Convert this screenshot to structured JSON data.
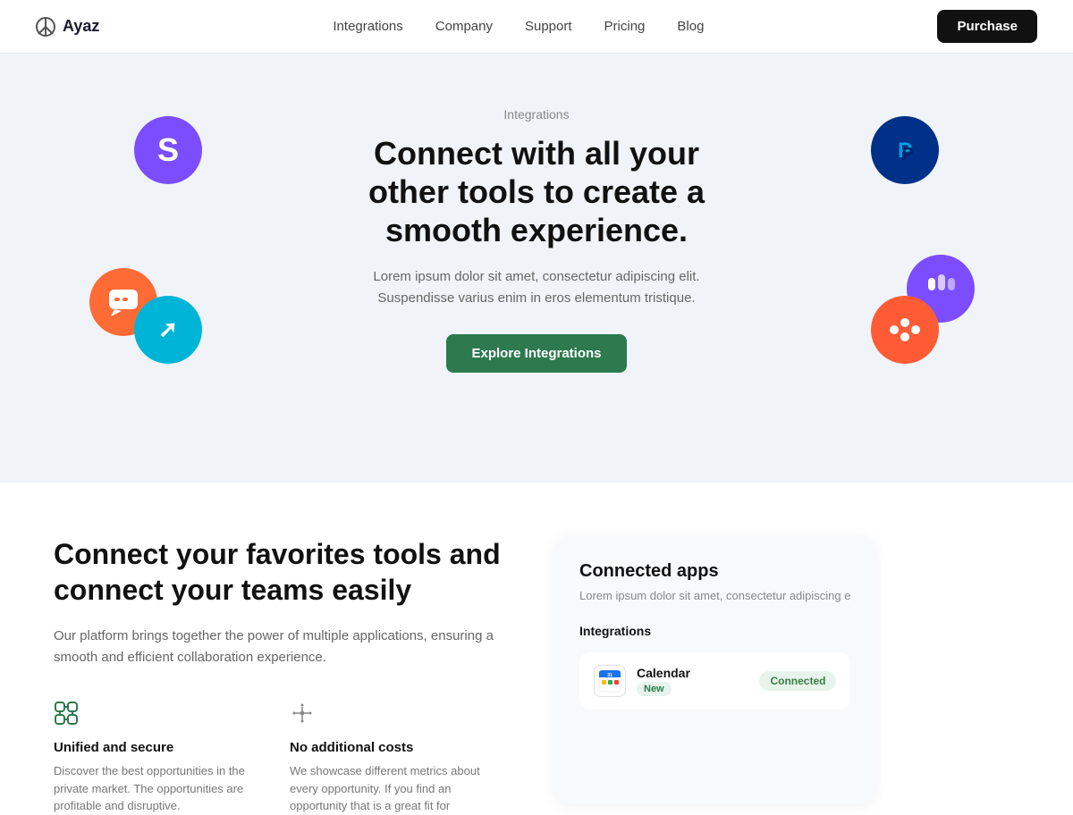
{
  "nav": {
    "logo": "Ayaz",
    "links": [
      "Integrations",
      "Company",
      "Support",
      "Pricing",
      "Blog"
    ],
    "purchase": "Purchase"
  },
  "integrations_section": {
    "label": "Integrations",
    "title": "Connect with all your other tools to create a smooth experience.",
    "description": "Lorem ipsum dolor sit amet, consectetur adipiscing elit. Suspendisse varius enim in eros elementum tristique.",
    "cta": "Explore Integrations"
  },
  "bottom_section": {
    "title": "Connect your favorites tools and connect your teams easily",
    "description": "Our platform brings together the power of multiple applications, ensuring a smooth and efficient collaboration experience.",
    "features": [
      {
        "icon": "⌘",
        "icon_type": "cmd",
        "title": "Unified and secure",
        "description": "Discover the best opportunities in the private market. The opportunities are profitable and disruptive."
      },
      {
        "icon": "✦",
        "icon_type": "stars",
        "title": "No additional costs",
        "description": "We showcase different metrics about every opportunity. If you find an opportunity that is a great fit for"
      }
    ]
  },
  "connected_apps": {
    "title": "Connected apps",
    "description": "Lorem ipsum dolor sit amet, consectetur adipiscing e",
    "integrations_label": "Integrations",
    "items": [
      {
        "name": "Calendar",
        "badge": "New",
        "status": "Connected"
      }
    ]
  }
}
